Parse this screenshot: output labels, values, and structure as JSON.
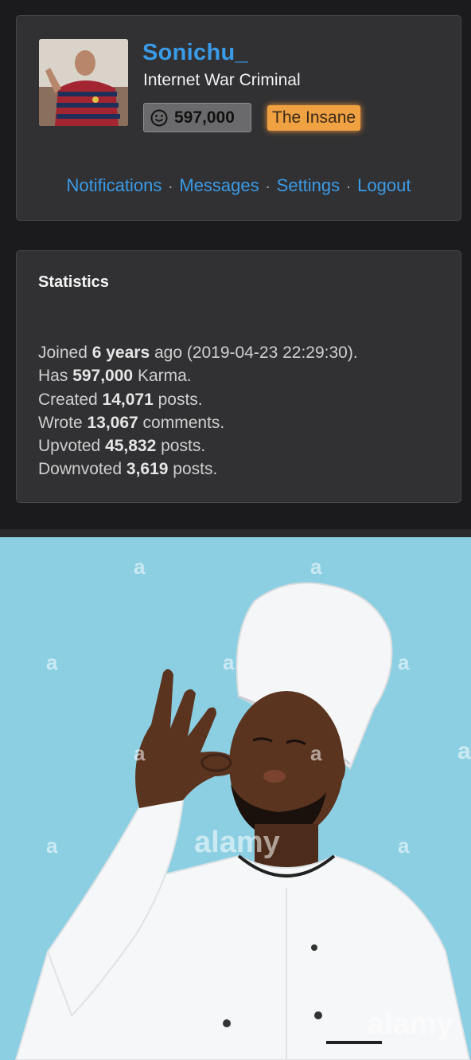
{
  "profile": {
    "username": "Sonichu_",
    "title": "Internet War Criminal",
    "karma": "597,000",
    "rank": "The Insane"
  },
  "nav": {
    "notifications": "Notifications",
    "messages": "Messages",
    "settings": "Settings",
    "logout": "Logout",
    "separator": "·"
  },
  "stats": {
    "heading": "Statistics",
    "joined": {
      "prefix": "Joined ",
      "value": "6 years",
      "suffix": " ago (2019-04-23 22:29:30)."
    },
    "karma": {
      "prefix": "Has ",
      "value": "597,000",
      "suffix": " Karma."
    },
    "created": {
      "prefix": "Created ",
      "value": "14,071",
      "suffix": " posts."
    },
    "wrote": {
      "prefix": "Wrote ",
      "value": "13,067",
      "suffix": " comments."
    },
    "upvoted": {
      "prefix": "Upvoted ",
      "value": "45,832",
      "suffix": " posts."
    },
    "downvoted": {
      "prefix": "Downvoted ",
      "value": "3,619",
      "suffix": " posts."
    }
  },
  "photo": {
    "watermarks": [
      "a",
      "alamy"
    ]
  },
  "colors": {
    "accent": "#3a9be8",
    "badge": "#f0a242",
    "card": "#313133",
    "photo_bg": "#8ccfe2"
  },
  "icons": {
    "karma": "smiley-icon"
  }
}
